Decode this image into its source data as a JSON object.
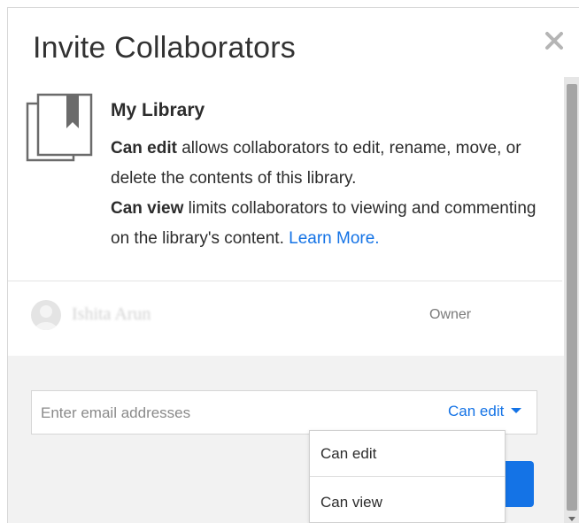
{
  "dialog": {
    "title": "Invite Collaborators",
    "close_icon": "close-icon"
  },
  "library": {
    "icon": "library-icon",
    "name": "My Library",
    "desc_edit_bold": "Can edit",
    "desc_edit_text": " allows collaborators to edit, rename, move, or delete the contents of this library.",
    "desc_view_bold": "Can view",
    "desc_view_text": " limits collaborators to viewing and commenting on the library's content. ",
    "learn_more": "Learn More."
  },
  "owner": {
    "name": "Ishita Arun",
    "role": "Owner"
  },
  "invite": {
    "email_placeholder": "Enter email addresses",
    "permission_selected": "Can edit"
  },
  "permission_menu": {
    "options": [
      "Can edit",
      "Can view"
    ]
  },
  "colors": {
    "accent": "#1473e6",
    "text": "#2c2c2c",
    "panel_gray": "#f2f2f2"
  }
}
